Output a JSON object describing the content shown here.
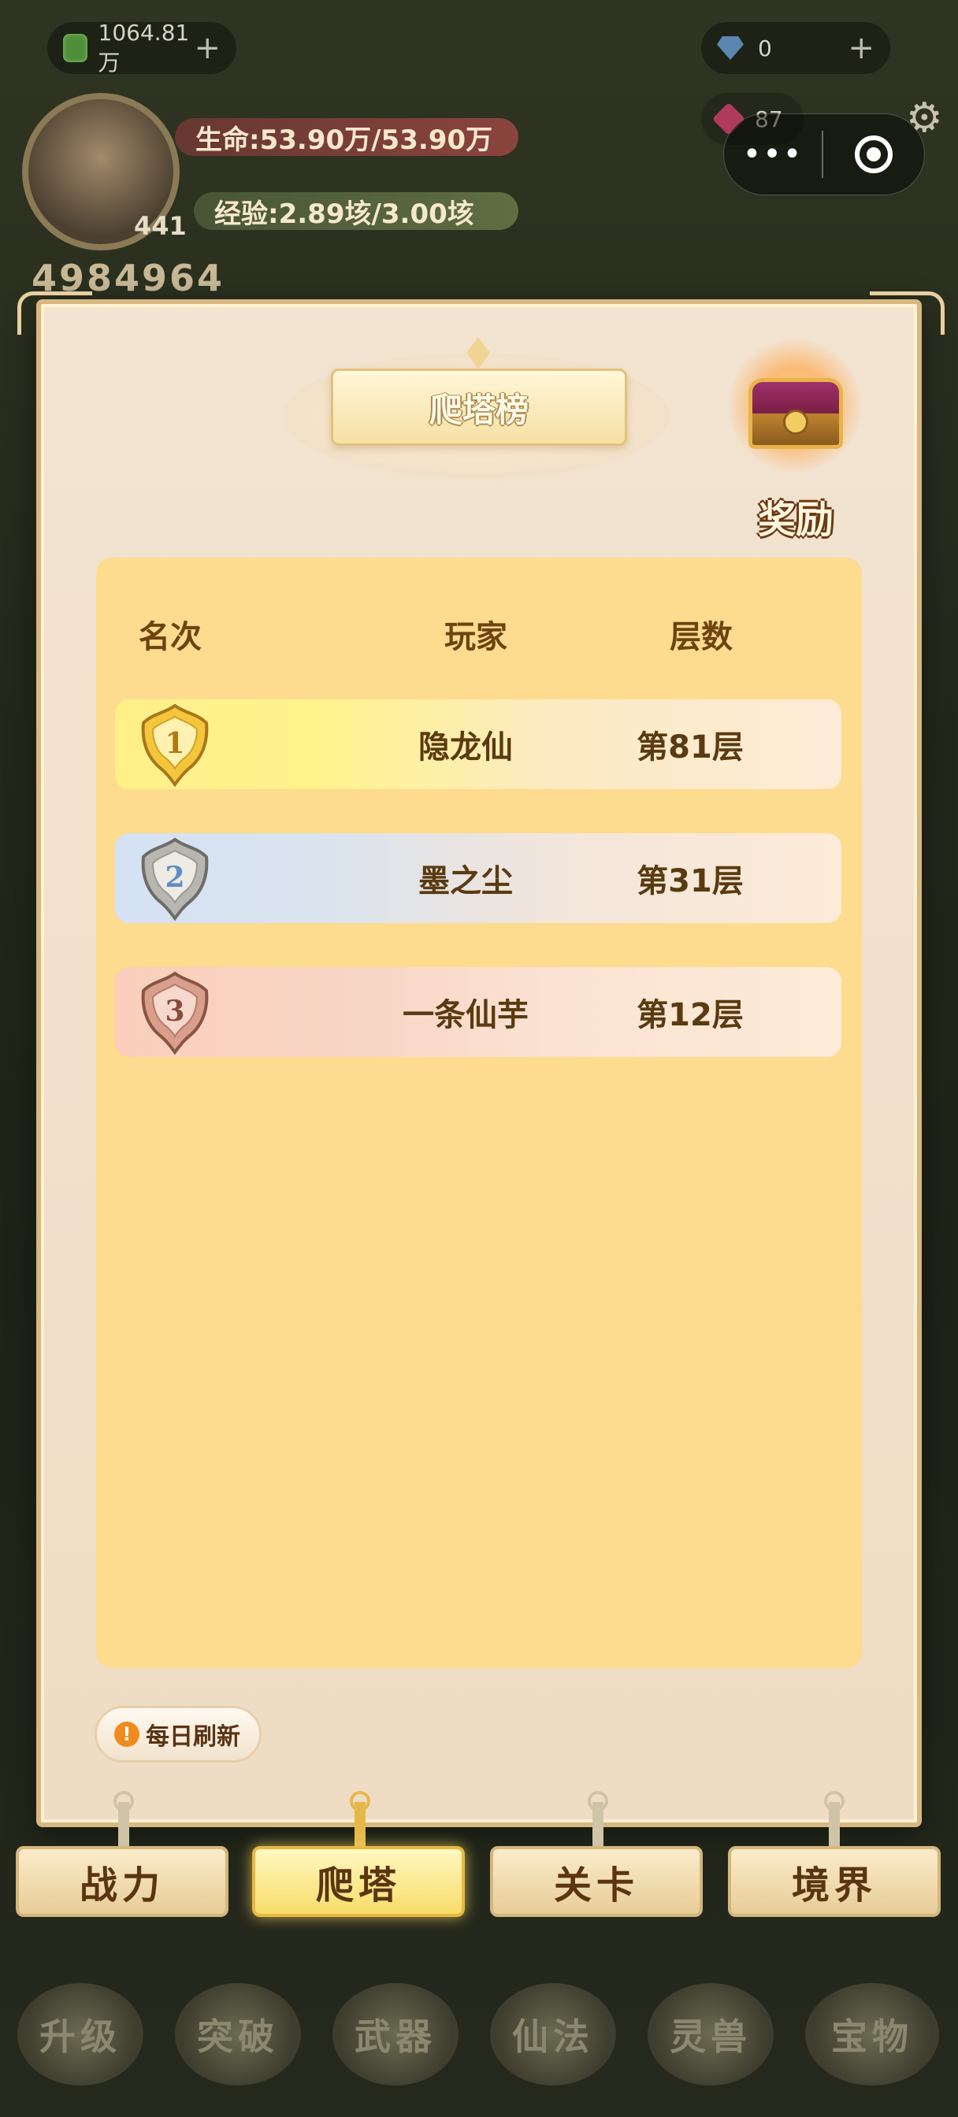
{
  "hud": {
    "currency": "1064.81万",
    "diamonds": "0",
    "rubies": "87",
    "hp_text": "生命:53.90万/53.90万",
    "exp_text": "经验:2.89垓/3.00垓",
    "level": "441",
    "power": "4984964"
  },
  "panel": {
    "title": "爬塔榜",
    "reward_label": "奖励",
    "daily_refresh": "每日刷新"
  },
  "table": {
    "headers": [
      "名次",
      "玩家",
      "层数"
    ],
    "rows": [
      {
        "rank": "1",
        "player": "隐龙仙",
        "floor": "第81层"
      },
      {
        "rank": "2",
        "player": "墨之尘",
        "floor": "第31层"
      },
      {
        "rank": "3",
        "player": "一条仙芋",
        "floor": "第12层"
      }
    ]
  },
  "tabs": [
    "战力",
    "爬塔",
    "关卡",
    "境界"
  ],
  "skills": [
    "升级",
    "突破",
    "武器",
    "仙法",
    "灵兽",
    "宝物"
  ],
  "colors": {
    "gold": "#e6b84a",
    "table_bg": "#fddb8f",
    "text_brown": "#5a3a10"
  }
}
